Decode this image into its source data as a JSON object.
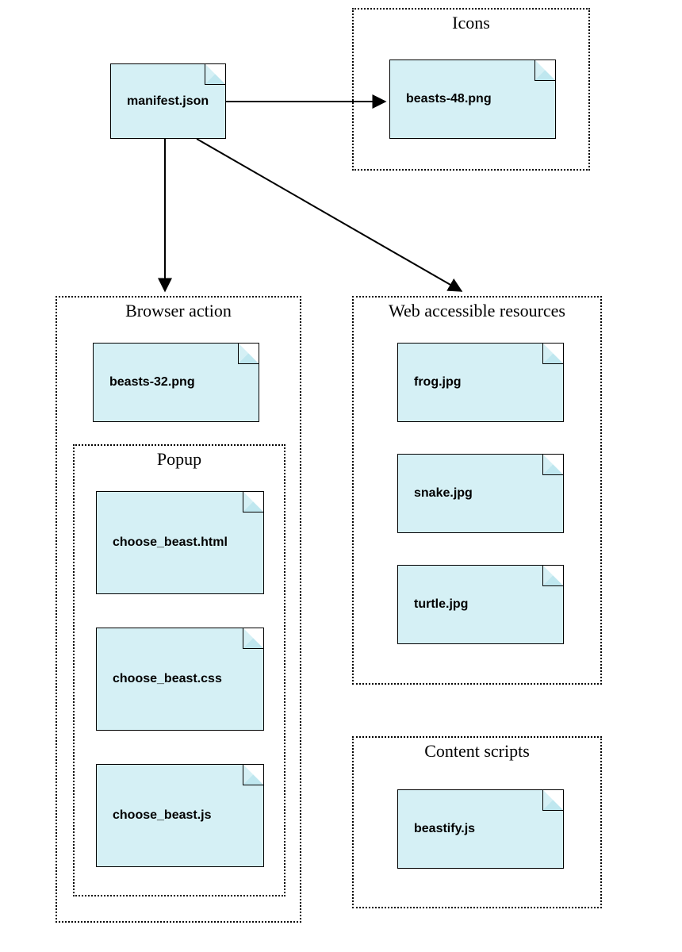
{
  "groups": {
    "icons": "Icons",
    "browser_action": "Browser action",
    "popup": "Popup",
    "web_resources": "Web accessible resources",
    "content_scripts": "Content scripts"
  },
  "files": {
    "manifest": "manifest.json",
    "beasts48": "beasts-48.png",
    "beasts32": "beasts-32.png",
    "choose_html": "choose_beast.html",
    "choose_css": "choose_beast.css",
    "choose_js": "choose_beast.js",
    "frog": "frog.jpg",
    "snake": "snake.jpg",
    "turtle": "turtle.jpg",
    "beastify": "beastify.js"
  }
}
